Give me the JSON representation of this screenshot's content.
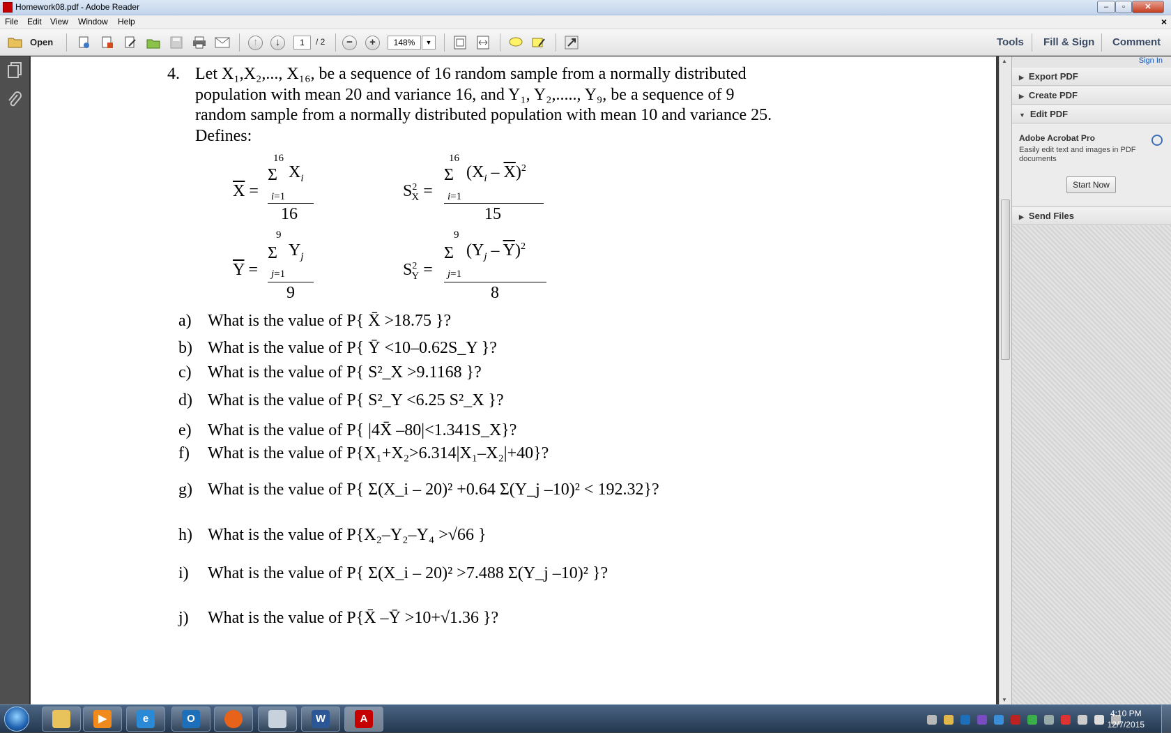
{
  "window": {
    "title": "Homework08.pdf - Adobe Reader"
  },
  "menu": [
    "File",
    "Edit",
    "View",
    "Window",
    "Help"
  ],
  "toolbar": {
    "open_label": "Open",
    "page_current": "1",
    "page_total": "/ 2",
    "zoom": "148%",
    "tools_label": "Tools",
    "fill_sign_label": "Fill & Sign",
    "comment_label": "Comment"
  },
  "right_pane": {
    "sign_in": "Sign In",
    "items": [
      {
        "label": "Export PDF",
        "expanded": false
      },
      {
        "label": "Create PDF",
        "expanded": false
      },
      {
        "label": "Edit PDF",
        "expanded": true
      },
      {
        "label": "Send Files",
        "expanded": false
      }
    ],
    "promo_title": "Adobe Acrobat Pro",
    "promo_text": "Easily edit text and images in PDF documents",
    "start_now": "Start Now"
  },
  "document": {
    "problem_number": "4.",
    "intro_lines": [
      "Let X₁,X₂,..., X₁₆, be a sequence of 16 random sample from a normally distributed",
      "population with mean 20 and variance 16, and Y₁, Y₂,....., Y₉, be a sequence of 9",
      "random sample from a normally distributed population with mean 10 and  variance 25."
    ],
    "defines": "Defines:",
    "questions": [
      {
        "letter": "a)",
        "text": "What is the value of P{ X̄ >18.75 }?"
      },
      {
        "letter": "b)",
        "text": "What is the value of P{ Ȳ <10–0.62S_Y }?"
      },
      {
        "letter": "c)",
        "text": "What is the value of P{ S²_X >9.1168 }?"
      },
      {
        "letter": "d)",
        "text": "What is the value of P{ S²_Y <6.25 S²_X }?"
      },
      {
        "letter": "e)",
        "text": "What is the value of P{ |4X̄ –80|<1.341S_X}?"
      },
      {
        "letter": "f)",
        "text": "What is the value of P{X₁+X₂>6.314|X₁–X₂|+40}?"
      },
      {
        "letter": "g)",
        "text": "What is the value of P{ Σ(X_i – 20)² +0.64 Σ(Y_j –10)² < 192.32}?"
      },
      {
        "letter": "h)",
        "text": "What is the value of P{X₂–Y₂–Y₄ >√66 }"
      },
      {
        "letter": "i)",
        "text": "What is the value of P{ Σ(X_i – 20)² >7.488 Σ(Y_j –10)² }?"
      },
      {
        "letter": "j)",
        "text": "What is the value of  P{X̄ –Ȳ >10+√1.36 }?"
      }
    ]
  },
  "taskbar": {
    "time": "4:10 PM",
    "date": "12/7/2015"
  }
}
